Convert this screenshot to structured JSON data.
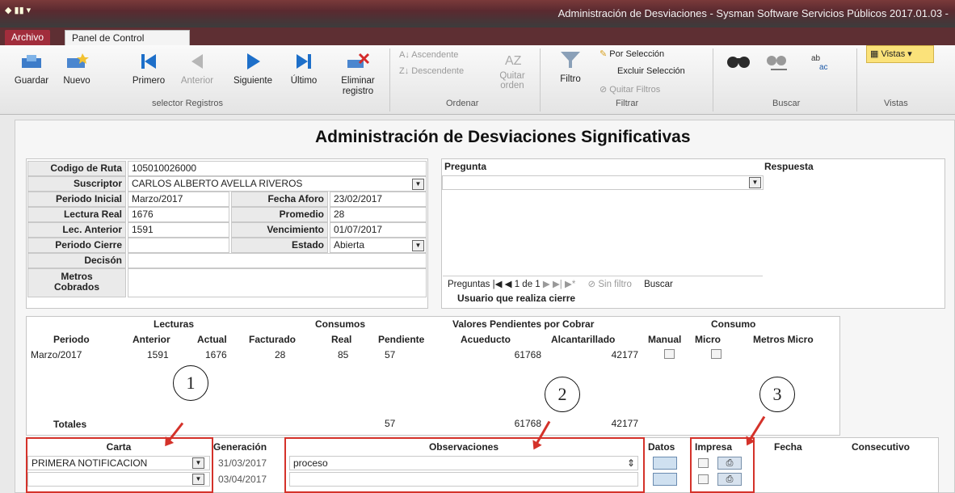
{
  "window": {
    "title": "Administración de Desviaciones - Sysman Software Servicios Públicos 2017.01.03 -"
  },
  "tabs": {
    "file": "Archivo",
    "control": "Panel de Control"
  },
  "ribbon": {
    "guardar": "Guardar",
    "nuevo": "Nuevo",
    "primero": "Primero",
    "anterior": "Anterior",
    "siguiente": "Siguiente",
    "ultimo": "Último",
    "eliminar_1": "Eliminar",
    "eliminar_2": "registro",
    "selector_group": "selector Registros",
    "ascendente": "Ascendente",
    "descendente": "Descendente",
    "quitar_1": "Quitar",
    "quitar_2": "orden",
    "ordenar_group": "Ordenar",
    "filtro": "Filtro",
    "por_seleccion": "Por Selección",
    "excluir_seleccion": "Excluir Selección",
    "quitar_filtros": "Quitar Filtros",
    "filtrar_group": "Filtrar",
    "buscar_group": "Buscar",
    "vistas": "Vistas",
    "vistas_group": "Vistas"
  },
  "heading": "Administración de Desviaciones Significativas",
  "record": {
    "codigo_ruta_label": "Codigo de Ruta",
    "codigo_ruta": "105010026000",
    "suscriptor_label": "Suscriptor",
    "suscriptor": "CARLOS ALBERTO AVELLA RIVEROS",
    "periodo_inicial_label": "Periodo Inicial",
    "periodo_inicial": "Marzo/2017",
    "fecha_aforo_label": "Fecha Aforo",
    "fecha_aforo": "23/02/2017",
    "lectura_real_label": "Lectura Real",
    "lectura_real": "1676",
    "promedio_label": "Promedio",
    "promedio": "28",
    "lec_anterior_label": "Lec. Anterior",
    "lec_anterior": "1591",
    "vencimiento_label": "Vencimiento",
    "vencimiento": "01/07/2017",
    "periodo_cierre_label": "Periodo Cierre",
    "estado_label": "Estado",
    "estado": "Abierta",
    "decision_label": "Decisón",
    "metros_label_1": "Metros",
    "metros_label_2": "Cobrados"
  },
  "questions": {
    "pregunta_header": "Pregunta",
    "respuesta_header": "Respuesta",
    "nav_label": "Preguntas",
    "nav_position": "1 de 1",
    "no_filter": "Sin filtro",
    "search": "Buscar",
    "usuario_cierre": "Usuario que realiza cierre"
  },
  "lecturas_table": {
    "group_lecturas": "Lecturas",
    "group_consumos": "Consumos",
    "group_valores": "Valores Pendientes por Cobrar",
    "group_consumo": "Consumo",
    "col_periodo": "Periodo",
    "col_anterior": "Anterior",
    "col_actual": "Actual",
    "col_facturado": "Facturado",
    "col_real": "Real",
    "col_pendiente": "Pendiente",
    "col_acueducto": "Acueducto",
    "col_alcantarillado": "Alcantarillado",
    "col_manual": "Manual",
    "col_micro": "Micro",
    "col_metros_micro": "Metros Micro",
    "row": {
      "periodo": "Marzo/2017",
      "anterior": "1591",
      "actual": "1676",
      "facturado": "28",
      "real": "85",
      "pendiente": "57",
      "acueducto": "61768",
      "alcantarillado": "42177"
    },
    "totales_label": "Totales",
    "tot_pendiente": "57",
    "tot_acueducto": "61768",
    "tot_alcantarillado": "42177"
  },
  "cartas": {
    "col_carta": "Carta",
    "col_generacion": "Generación",
    "col_observaciones": "Observaciones",
    "col_datos": "Datos",
    "col_impresa": "Impresa",
    "col_fecha": "Fecha",
    "col_consecutivo": "Consecutivo",
    "rows": [
      {
        "carta": "PRIMERA NOTIFICACION",
        "generacion": "31/03/2017",
        "observaciones": "proceso"
      },
      {
        "carta": "",
        "generacion": "03/04/2017",
        "observaciones": ""
      }
    ]
  },
  "annotations": {
    "one": "1",
    "two": "2",
    "three": "3"
  },
  "colors": {
    "annotation": "#d4322a",
    "file_tab": "#a12d3c"
  }
}
